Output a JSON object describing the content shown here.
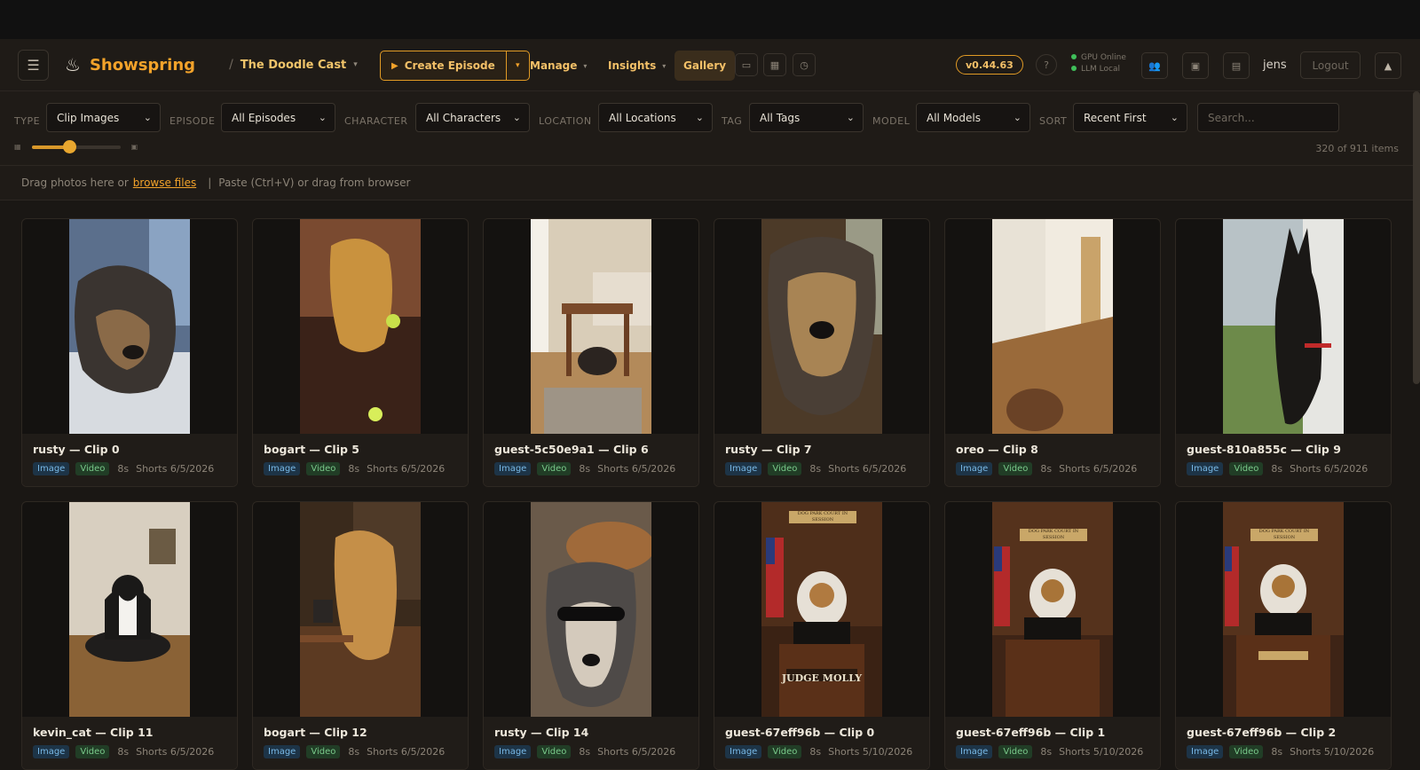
{
  "header": {
    "brand": "Showspring",
    "breadcrumb": "The Doodle Cast",
    "create_label": "Create Episode",
    "nav": {
      "manage": "Manage",
      "insights": "Insights",
      "gallery": "Gallery"
    },
    "version": "v0.44.63",
    "help": "?",
    "status": [
      "GPU Online",
      "LLM Local"
    ],
    "user": "jens",
    "logout": "Logout"
  },
  "filters": {
    "type": {
      "label": "TYPE",
      "value": "Clip Images"
    },
    "episode": {
      "label": "EPISODE",
      "value": "All Episodes"
    },
    "character": {
      "label": "CHARACTER",
      "value": "All Characters"
    },
    "location": {
      "label": "LOCATION",
      "value": "All Locations"
    },
    "tag": {
      "label": "TAG",
      "value": "All Tags"
    },
    "model": {
      "label": "MODEL",
      "value": "All Models"
    },
    "sort": {
      "label": "SORT",
      "value": "Recent First"
    },
    "search_placeholder": "Search...",
    "thumb_size_fraction": 0.42,
    "count": "320 of 911 items"
  },
  "dropbar": {
    "prefix": "Drag photos here or",
    "link": "browse files",
    "separator": "|",
    "suffix": "Paste (Ctrl+V) or drag from browser"
  },
  "cards": [
    {
      "title": "rusty — Clip 0",
      "type": "Image",
      "media": "Video",
      "duration": "8s",
      "format": "Shorts",
      "date": "6/5/2026"
    },
    {
      "title": "bogart — Clip 5",
      "type": "Image",
      "media": "Video",
      "duration": "8s",
      "format": "Shorts",
      "date": "6/5/2026"
    },
    {
      "title": "guest-5c50e9a1 — Clip 6",
      "type": "Image",
      "media": "Video",
      "duration": "8s",
      "format": "Shorts",
      "date": "6/5/2026"
    },
    {
      "title": "rusty — Clip 7",
      "type": "Image",
      "media": "Video",
      "duration": "8s",
      "format": "Shorts",
      "date": "6/5/2026"
    },
    {
      "title": "oreo — Clip 8",
      "type": "Image",
      "media": "Video",
      "duration": "8s",
      "format": "Shorts",
      "date": "6/5/2026"
    },
    {
      "title": "guest-810a855c — Clip 9",
      "type": "Image",
      "media": "Video",
      "duration": "8s",
      "format": "Shorts",
      "date": "6/5/2026"
    },
    {
      "title": "kevin_cat — Clip 11",
      "type": "Image",
      "media": "Video",
      "duration": "8s",
      "format": "Shorts",
      "date": "6/5/2026"
    },
    {
      "title": "bogart — Clip 12",
      "type": "Image",
      "media": "Video",
      "duration": "8s",
      "format": "Shorts",
      "date": "6/5/2026"
    },
    {
      "title": "rusty — Clip 14",
      "type": "Image",
      "media": "Video",
      "duration": "8s",
      "format": "Shorts",
      "date": "6/5/2026"
    },
    {
      "title": "guest-67eff96b — Clip 0",
      "type": "Image",
      "media": "Video",
      "duration": "8s",
      "format": "Shorts",
      "date": "5/10/2026"
    },
    {
      "title": "guest-67eff96b — Clip 1",
      "type": "Image",
      "media": "Video",
      "duration": "8s",
      "format": "Shorts",
      "date": "5/10/2026"
    },
    {
      "title": "guest-67eff96b — Clip 2",
      "type": "Image",
      "media": "Video",
      "duration": "8s",
      "format": "Shorts",
      "date": "5/10/2026"
    }
  ],
  "thumb_texts": {
    "judge_molly": "JUDGE MOLLY",
    "plaque": "DOG PARK COURT IN SESSION"
  }
}
